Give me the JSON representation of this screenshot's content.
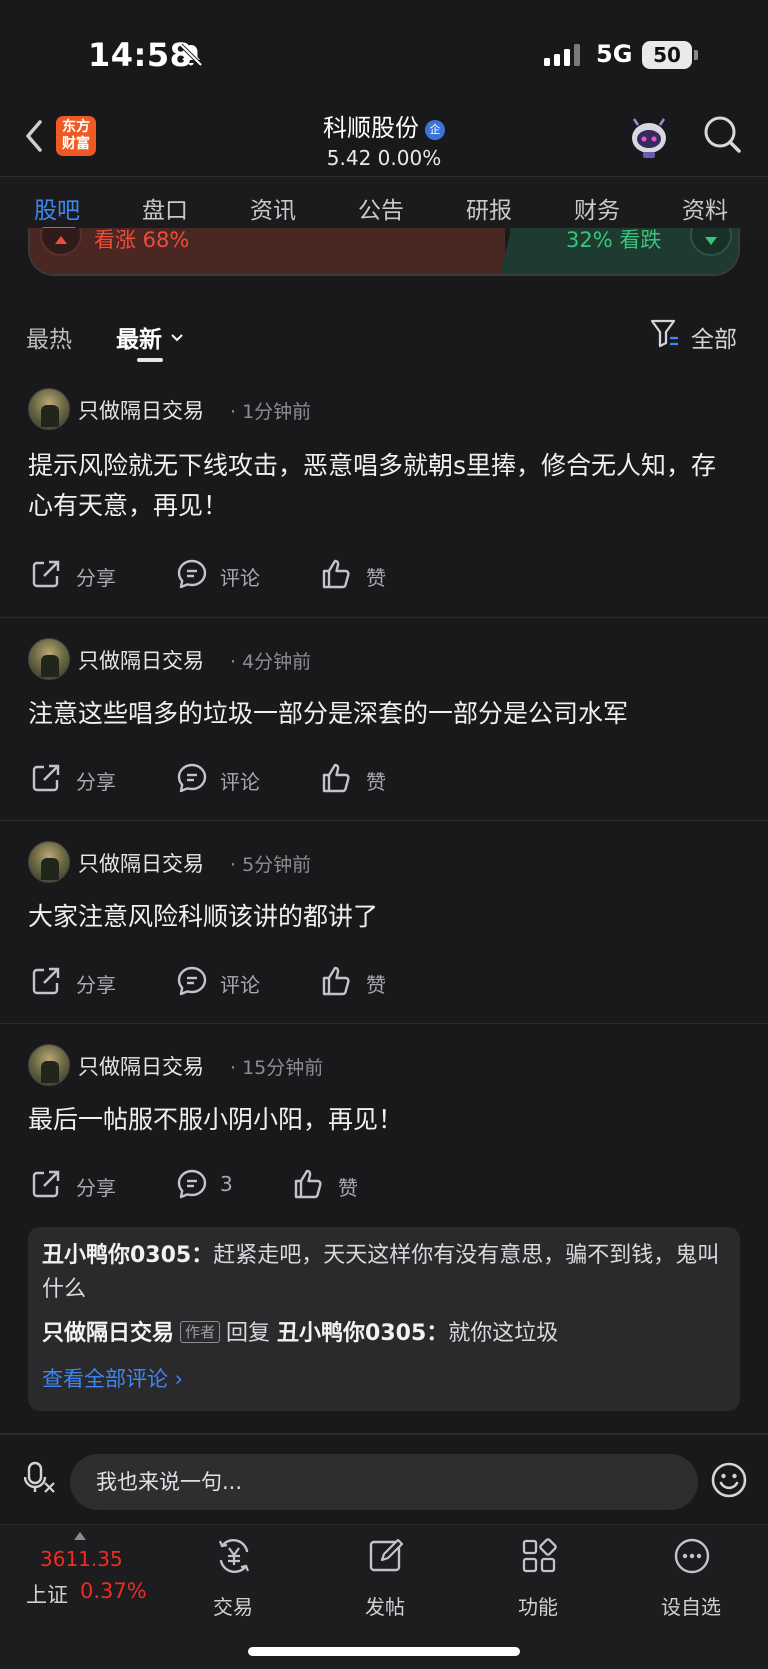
{
  "status_bar": {
    "time": "14:58",
    "network": "5G",
    "battery": "50"
  },
  "header": {
    "logo_line1": "东方",
    "logo_line2": "财富",
    "stock_name": "科顺股份",
    "badge": "企",
    "price_line": "5.42  0.00%"
  },
  "tabs": [
    "股吧",
    "盘口",
    "资讯",
    "公告",
    "研报",
    "财务",
    "资料"
  ],
  "active_tab": "股吧",
  "sentiment": {
    "up_label": "看涨 68%",
    "down_label": "32% 看跌",
    "up_percent": 68,
    "down_percent": 32
  },
  "filters": {
    "hot": "最热",
    "new": "最新",
    "all": "全部"
  },
  "actions": {
    "share": "分享",
    "comment": "评论",
    "like": "赞"
  },
  "posts": [
    {
      "user": "只做隔日交易",
      "time": "· 1分钟前",
      "text": "提示风险就无下线攻击，恶意唱多就朝s里捧，修合无人知，存心有天意，再见！",
      "comment": "评论"
    },
    {
      "user": "只做隔日交易",
      "time": "· 4分钟前",
      "text": "注意这些唱多的垃圾一部分是深套的一部分是公司水军",
      "comment": "评论"
    },
    {
      "user": "只做隔日交易",
      "time": "· 5分钟前",
      "text": "大家注意风险科顺该讲的都讲了",
      "comment": "评论"
    },
    {
      "user": "只做隔日交易",
      "time": "· 15分钟前",
      "text": "最后一帖服不服小阴小阳，再见！",
      "comment": "3"
    }
  ],
  "replies": {
    "r1_name": "丑小鸭你0305：",
    "r1_text": "赶紧走吧，天天这样你有没有意思，骗不到钱，鬼叫什么",
    "r2_name": "只做隔日交易",
    "r2_tag": "作者",
    "r2_reply": "回复",
    "r2_target": "丑小鸭你0305：",
    "r2_text": "就你这垃圾",
    "more": "查看全部评论 ›"
  },
  "input": {
    "placeholder": "我也来说一句..."
  },
  "bottom_nav": {
    "index_value": "3611.35",
    "index_name": "上证",
    "index_pct": "0.37%",
    "items": [
      "交易",
      "发帖",
      "功能",
      "设自选"
    ]
  },
  "colors": {
    "accent": "#3d87f0",
    "up": "#ef4d3a",
    "down": "#34c77a",
    "background": "#19191b"
  }
}
